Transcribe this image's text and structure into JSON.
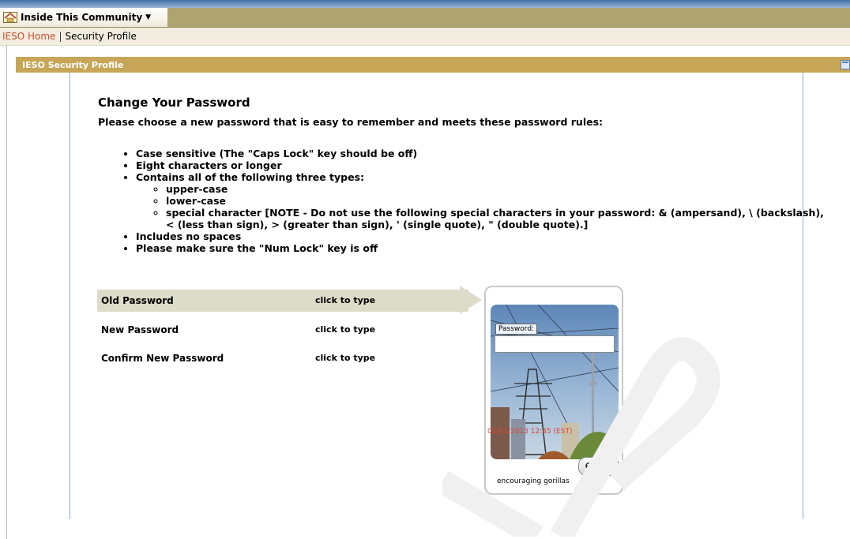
{
  "header": {
    "community_menu": "Inside This Community"
  },
  "breadcrumb": {
    "home": "IESO Home",
    "separator": "|",
    "current": "Security Profile"
  },
  "panel": {
    "title": "IESO Security Profile"
  },
  "main": {
    "heading": "Change Your Password",
    "intro": "Please choose a new password that is easy to remember and meets these password rules:",
    "rules": {
      "r1": "Case sensitive (The \"Caps Lock\" key should be off)",
      "r2": "Eight characters or longer",
      "r3": "Contains all of the following three types:",
      "r3_sub": {
        "a": "upper-case",
        "b": "lower-case",
        "c": "special character [NOTE - Do not use the following special characters in your password: & (ampersand), \\ (backslash), < (less than sign), > (greater than sign), ' (single quote), \" (double quote).]"
      },
      "r4": "Includes no spaces",
      "r5": "Please make sure the \"Num Lock\" key is off"
    }
  },
  "form": {
    "old_label": "Old Password",
    "old_value": "click to type",
    "new_label": "New Password",
    "new_value": "click to type",
    "confirm_label": "Confirm New Password",
    "confirm_value": "click to type"
  },
  "keypad": {
    "password_label": "Password:",
    "timestamp": "01/01/2013 12:45 (EST)",
    "enter_label": "enter",
    "phrase": "encouraging gorillas"
  },
  "colors": {
    "topbar": "#ada46f",
    "panel_header": "#c7a658",
    "link": "#c8502b",
    "active_row": "#dcdcc8"
  }
}
